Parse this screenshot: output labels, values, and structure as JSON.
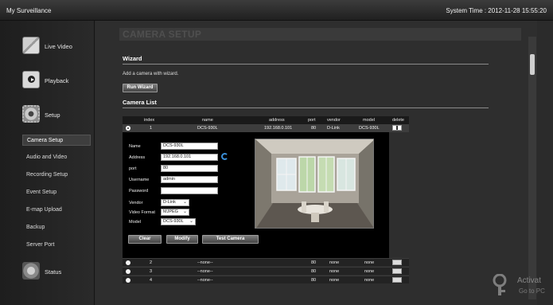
{
  "header": {
    "app_title": "My Surveillance",
    "system_time": "System Time : 2012-11-28 15:55:20"
  },
  "sidebar": {
    "main": [
      {
        "label": "Live Video",
        "icon": "live-video-icon"
      },
      {
        "label": "Playback",
        "icon": "playback-icon"
      },
      {
        "label": "Setup",
        "icon": "gear-icon"
      },
      {
        "label": "Status",
        "icon": "status-icon"
      }
    ],
    "setup_items": [
      {
        "label": "Camera Setup",
        "active": true
      },
      {
        "label": "Audio and Video",
        "active": false
      },
      {
        "label": "Recording Setup",
        "active": false
      },
      {
        "label": "Event Setup",
        "active": false
      },
      {
        "label": "E-map Upload",
        "active": false
      },
      {
        "label": "Backup",
        "active": false
      },
      {
        "label": "Server Port",
        "active": false
      }
    ]
  },
  "page": {
    "title": "CAMERA SETUP",
    "wizard": {
      "heading": "Wizard",
      "description": "Add a camera with wizard.",
      "button": "Run Wizard"
    },
    "camera_list": {
      "heading": "Camera List",
      "columns": [
        "index",
        "name",
        "address",
        "port",
        "vendor",
        "model",
        "delete"
      ],
      "selected_row": {
        "index": "1",
        "name": "DCS-930L",
        "address": "192.168.0.101",
        "port": "80",
        "vendor": "D-Link",
        "model": "DCS-930L"
      },
      "other_rows": [
        {
          "index": "2",
          "name": "--none--",
          "port": "80",
          "vendor": "none",
          "model": "none"
        },
        {
          "index": "3",
          "name": "--none--",
          "port": "80",
          "vendor": "none",
          "model": "none"
        },
        {
          "index": "4",
          "name": "--none--",
          "port": "80",
          "vendor": "none",
          "model": "none"
        }
      ]
    },
    "form": {
      "name": {
        "label": "Name",
        "value": "DCS-930L"
      },
      "address": {
        "label": "Address",
        "value": "192.168.0.101"
      },
      "port": {
        "label": "port",
        "value": "80"
      },
      "username": {
        "label": "Username",
        "value": "admin"
      },
      "password": {
        "label": "Password",
        "value": ""
      },
      "vendor": {
        "label": "Vendor",
        "value": "D-Link"
      },
      "video_format": {
        "label": "Video Format",
        "value": "MJPEG"
      },
      "model": {
        "label": "Model",
        "value": "DCS-930L"
      },
      "buttons": {
        "clear": "Clear",
        "modify": "Modify",
        "test": "Test Camera"
      }
    }
  },
  "watermark": {
    "line1": "Activat",
    "line2": "Go to PC"
  },
  "colors": {
    "background": "#2e2e2e",
    "sidebar": "#222222",
    "header": "#2a2a2a",
    "refresh_icon": "#3a8fd8"
  }
}
